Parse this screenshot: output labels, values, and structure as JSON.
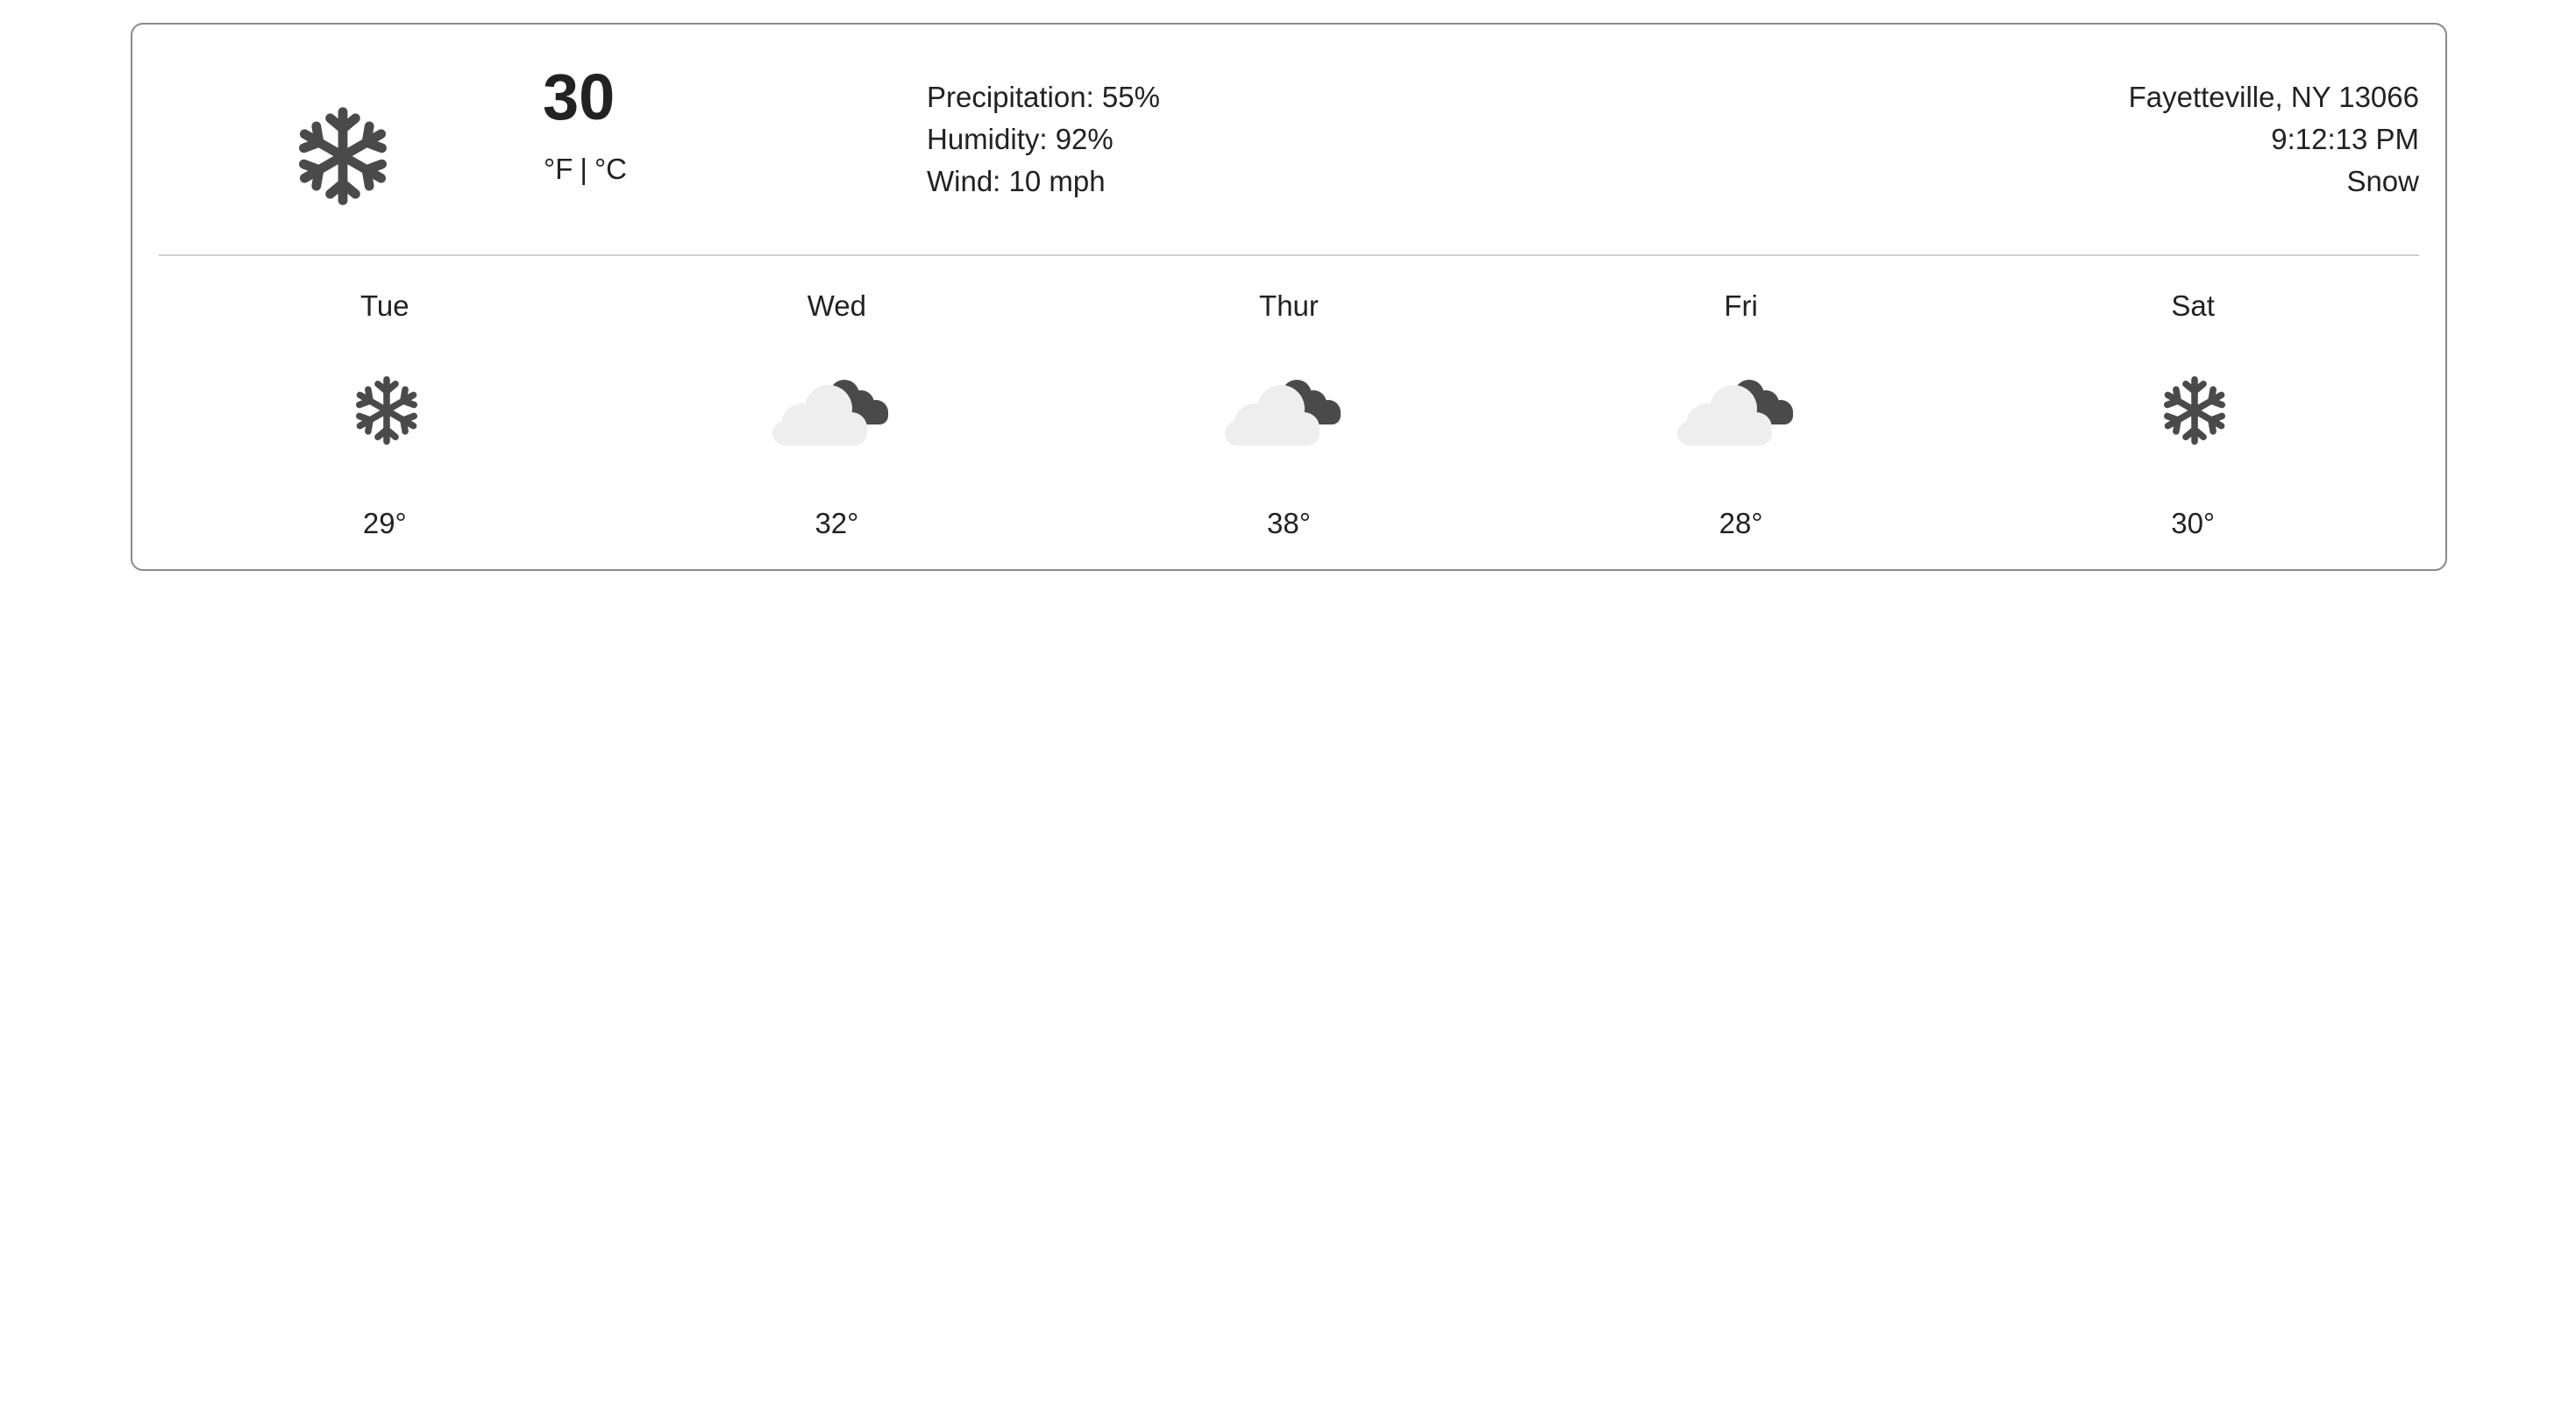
{
  "current": {
    "icon": "snowflake-icon",
    "temperature": "30",
    "unit_f": "°F",
    "unit_separator": "|",
    "unit_c": "°C",
    "precipitation": "Precipitation: 55%",
    "humidity": "Humidity: 92%",
    "wind": "Wind: 10 mph",
    "location": "Fayetteville, NY 13066",
    "time": "9:12:13 PM",
    "condition": "Snow"
  },
  "forecast": [
    {
      "day": "Tue",
      "icon": "snowflake-icon",
      "temp": "29°"
    },
    {
      "day": "Wed",
      "icon": "partly-cloudy-night-icon",
      "temp": "32°"
    },
    {
      "day": "Thur",
      "icon": "partly-cloudy-night-icon",
      "temp": "38°"
    },
    {
      "day": "Fri",
      "icon": "partly-cloudy-night-icon",
      "temp": "28°"
    },
    {
      "day": "Sat",
      "icon": "snowflake-icon",
      "temp": "30°"
    }
  ],
  "colors": {
    "icon_dark": "#4a4a4a",
    "cloud_light": "#eeeeee",
    "border": "#8a8a8a",
    "divider": "#cfcfcf"
  }
}
